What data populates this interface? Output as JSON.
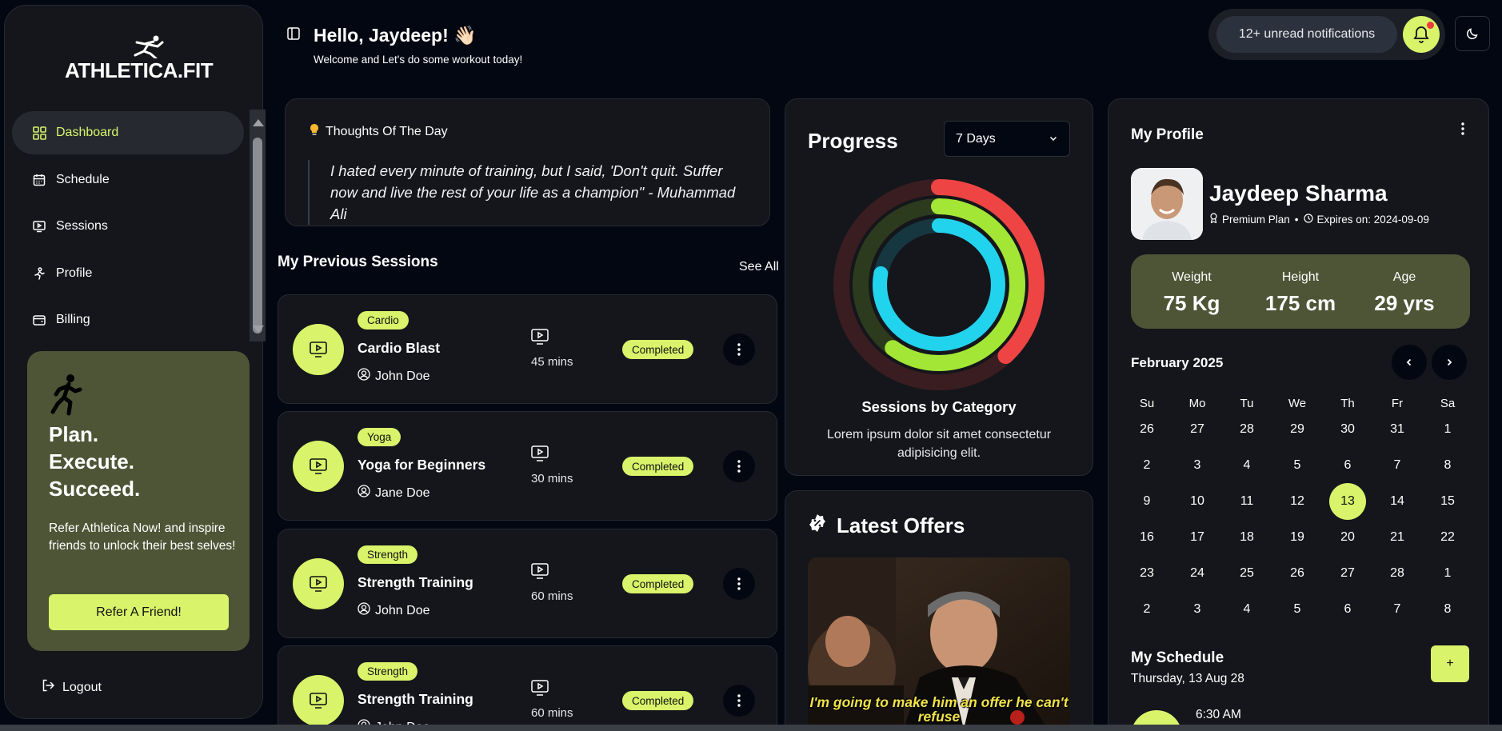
{
  "sidebar": {
    "logo": "ATHLETICA.FIT",
    "items": [
      {
        "label": "Dashboard",
        "icon": "grid-icon"
      },
      {
        "label": "Schedule",
        "icon": "calendar-icon"
      },
      {
        "label": "Sessions",
        "icon": "video-icon"
      },
      {
        "label": "Profile",
        "icon": "person-icon"
      },
      {
        "label": "Billing",
        "icon": "wallet-icon"
      }
    ],
    "promo": {
      "title": "Plan.\nExecute.\nSucceed.",
      "text": "Refer Athletica Now! and inspire friends to unlock their best selves!",
      "button": "Refer A Friend!"
    },
    "logout": "Logout"
  },
  "header": {
    "greeting": "Hello, Jaydeep! 👋🏻",
    "subtitle": "Welcome and Let's do some workout today!",
    "notifications": "12+ unread notifications"
  },
  "thought": {
    "title": "Thoughts Of The Day",
    "quote": "I hated every minute of training, but I said, 'Don't quit. Suffer now and live the rest of your life as a champion\" - Muhammad Ali"
  },
  "sessions": {
    "title": "My Previous Sessions",
    "see_all": "See All",
    "items": [
      {
        "tag": "Cardio",
        "name": "Cardio Blast",
        "coach": "John Doe",
        "duration": "45 mins",
        "status": "Completed"
      },
      {
        "tag": "Yoga",
        "name": "Yoga for Beginners",
        "coach": "Jane Doe",
        "duration": "30 mins",
        "status": "Completed"
      },
      {
        "tag": "Strength",
        "name": "Strength Training",
        "coach": "John Doe",
        "duration": "60 mins",
        "status": "Completed"
      },
      {
        "tag": "Strength",
        "name": "Strength Training",
        "coach": "John Doe",
        "duration": "60 mins",
        "status": "Completed"
      }
    ]
  },
  "progress": {
    "title": "Progress",
    "range": "7 Days",
    "chart_title": "Sessions by Category",
    "chart_desc": "Lorem ipsum dolor sit amet consectetur adipisicing elit.",
    "rings": [
      {
        "color": "#ef4444",
        "track": "#3a1d20",
        "fraction": 0.38
      },
      {
        "color": "#a3e635",
        "track": "#2c3a1e",
        "fraction": 0.6
      },
      {
        "color": "#22d3ee",
        "track": "#163740",
        "fraction": 0.78
      }
    ]
  },
  "offers": {
    "title": "Latest Offers",
    "caption": "I'm going to make him an offer he can't refuse"
  },
  "profile": {
    "title": "My Profile",
    "name": "Jaydeep Sharma",
    "plan": "Premium Plan",
    "expires": "Expires on: 2024-09-09",
    "stats": [
      {
        "label": "Weight",
        "value": "75 Kg"
      },
      {
        "label": "Height",
        "value": "175 cm"
      },
      {
        "label": "Age",
        "value": "29 yrs"
      }
    ]
  },
  "calendar": {
    "month": "February 2025",
    "dow": [
      "Su",
      "Mo",
      "Tu",
      "We",
      "Th",
      "Fr",
      "Sa"
    ],
    "days": [
      "26",
      "27",
      "28",
      "29",
      "30",
      "31",
      "1",
      "2",
      "3",
      "4",
      "5",
      "6",
      "7",
      "8",
      "9",
      "10",
      "11",
      "12",
      "13",
      "14",
      "15",
      "16",
      "17",
      "18",
      "19",
      "20",
      "21",
      "22",
      "23",
      "24",
      "25",
      "26",
      "27",
      "28",
      "1",
      "2",
      "3",
      "4",
      "5",
      "6",
      "7",
      "8"
    ],
    "today": "13"
  },
  "schedule": {
    "title": "My Schedule",
    "date": "Thursday, 13 Aug 28",
    "add": "+",
    "time": "6:30 AM"
  },
  "colors": {
    "accent": "#d9f36a",
    "background": "#030712",
    "card": "#14161b",
    "promo": "#4d5536"
  }
}
